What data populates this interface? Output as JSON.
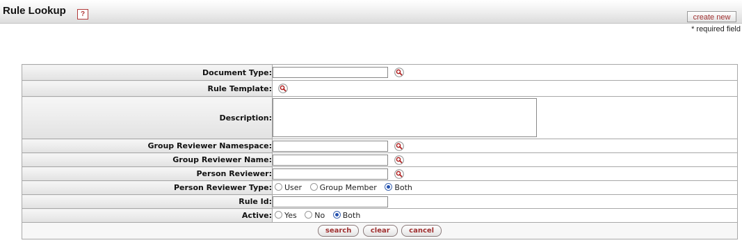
{
  "header": {
    "title": "Rule Lookup",
    "help_label": "?",
    "create_new_label": "create new"
  },
  "required_note": "* required field",
  "form": {
    "document_type": {
      "label": "Document Type:",
      "value": ""
    },
    "rule_template": {
      "label": "Rule Template:"
    },
    "description": {
      "label": "Description:",
      "value": ""
    },
    "group_reviewer_namespace": {
      "label": "Group Reviewer Namespace:",
      "value": ""
    },
    "group_reviewer_name": {
      "label": "Group Reviewer Name:",
      "value": ""
    },
    "person_reviewer": {
      "label": "Person Reviewer:",
      "value": ""
    },
    "person_reviewer_type": {
      "label": "Person Reviewer Type:",
      "options": [
        "User",
        "Group Member",
        "Both"
      ],
      "selected": "Both"
    },
    "rule_id": {
      "label": "Rule Id:",
      "value": ""
    },
    "active": {
      "label": "Active:",
      "options": [
        "Yes",
        "No",
        "Both"
      ],
      "selected": "Both"
    }
  },
  "buttons": {
    "search": "search",
    "clear": "clear",
    "cancel": "cancel"
  },
  "icons": {
    "lookup": "magnifier-lookup-icon",
    "help": "help-icon"
  },
  "colors": {
    "button_text": "#a03030",
    "radio_selected": "#2351b0",
    "help_border": "#b13a3a"
  }
}
